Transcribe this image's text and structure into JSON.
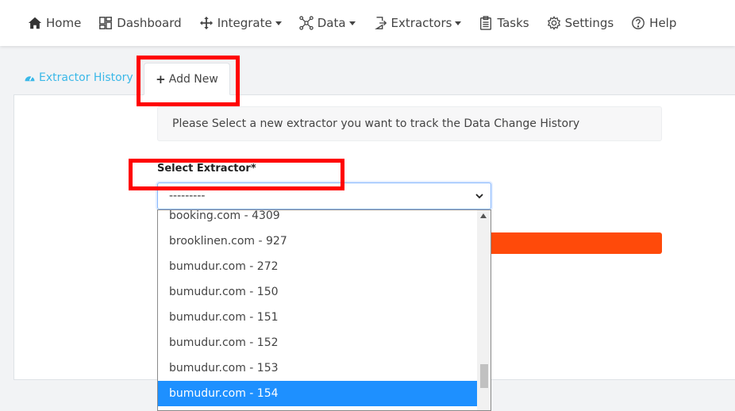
{
  "nav": {
    "items": [
      {
        "label": "Home",
        "icon": "home-icon",
        "dropdown": false
      },
      {
        "label": "Dashboard",
        "icon": "dashboard-icon",
        "dropdown": false
      },
      {
        "label": "Integrate",
        "icon": "move-icon",
        "dropdown": true
      },
      {
        "label": "Data",
        "icon": "data-nodes-icon",
        "dropdown": true
      },
      {
        "label": "Extractors",
        "icon": "sign-in-icon",
        "dropdown": true
      },
      {
        "label": "Tasks",
        "icon": "clipboard-icon",
        "dropdown": false
      },
      {
        "label": "Settings",
        "icon": "gear-icon",
        "dropdown": false
      },
      {
        "label": "Help",
        "icon": "question-circle-icon",
        "dropdown": false
      }
    ]
  },
  "tabs": {
    "history_label": "Extractor History",
    "add_new_label": "Add New"
  },
  "form": {
    "info_text": "Please Select a new extractor you want to track the Data Change History",
    "select_label": "Select Extractor*",
    "select_value": "---------"
  },
  "dropdown": {
    "options": [
      "booking.com - 4309",
      "brooklinen.com - 927",
      "bumudur.com - 272",
      "bumudur.com - 150",
      "bumudur.com - 151",
      "bumudur.com - 152",
      "bumudur.com - 153",
      "bumudur.com - 154"
    ],
    "selected": "bumudur.com - 154"
  },
  "colors": {
    "accent_link": "#3bb8e8",
    "submit_button": "#ff4a0a",
    "selected_option": "#1e90ff",
    "highlight": "#ff0000"
  }
}
